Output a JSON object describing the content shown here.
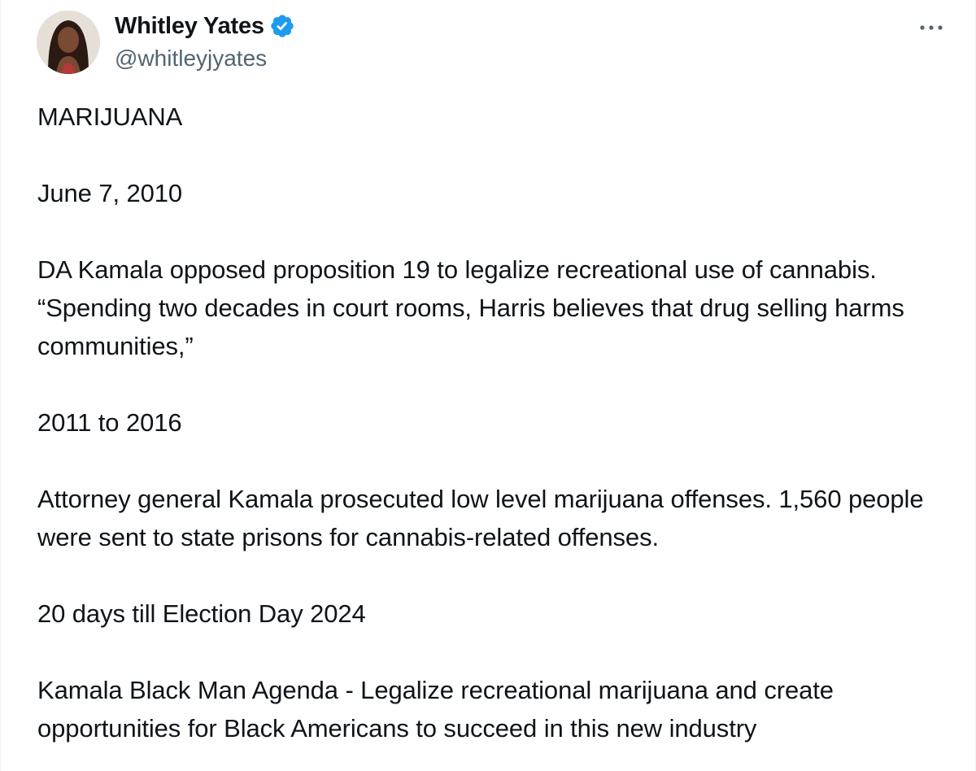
{
  "author": {
    "display_name": "Whitley Yates",
    "handle": "@whitleyjyates",
    "verified": true,
    "verified_color": "#1d9bf0"
  },
  "menu": {
    "icon": "more-dots-icon"
  },
  "tweet": {
    "paragraphs": [
      "MARIJUANA",
      "June 7, 2010",
      "DA Kamala opposed proposition 19 to legalize recreational use of cannabis. “Spending two decades in court rooms, Harris believes that drug selling harms communities,”",
      "2011 to 2016",
      "Attorney general Kamala prosecuted low level marijuana offenses. 1,560 people were sent to state prisons for cannabis-related offenses.",
      "20 days till Election Day 2024",
      "Kamala Black Man Agenda - Legalize recreational marijuana and create opportunities for Black Americans to succeed in this new industry"
    ]
  },
  "colors": {
    "text": "#0f1419",
    "secondary": "#536471",
    "accent": "#1d9bf0"
  }
}
